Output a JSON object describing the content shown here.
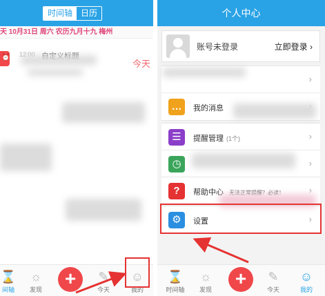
{
  "left_screen": {
    "toggle": {
      "timeline_label": "时间轴",
      "calendar_label": "日历"
    },
    "date_bar": "天 10月31日 周六 农历九月十九 梅州",
    "entry": {
      "time": "12:00",
      "title": "自定义标题",
      "today": "今天"
    }
  },
  "right_screen": {
    "title": "个人中心",
    "account": {
      "label": "账号未登录",
      "login": "立即登录"
    },
    "menu": [
      {
        "label": "我的消息"
      },
      {
        "label": "提醒管理",
        "sub": "(1个)"
      },
      {
        "label": "帮助中心",
        "note": "无法正常提醒？必读！"
      },
      {
        "label": "设置"
      }
    ]
  },
  "tabbar": {
    "timeline": "时间轴",
    "discover": "发现",
    "today": "今天",
    "mine": "我的"
  },
  "left_tabbar": {
    "timeline": "间轴",
    "discover": "发现",
    "today": "今天",
    "mine": "我的"
  },
  "colors": {
    "accent": "#2aa3e6",
    "red": "#e53232",
    "pink": "#e0467a"
  }
}
